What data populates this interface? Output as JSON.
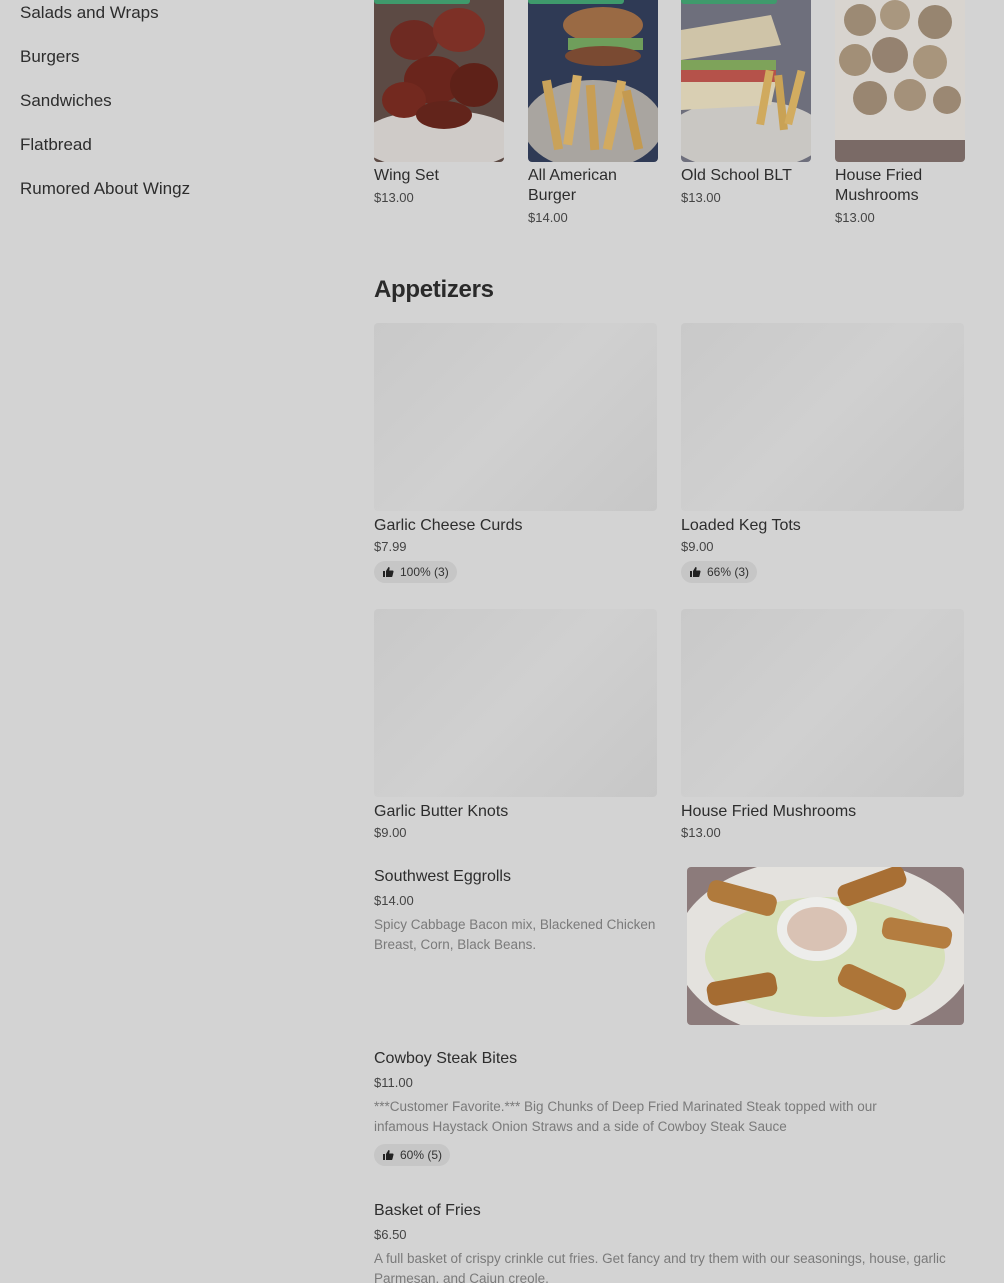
{
  "sidebar": {
    "items": [
      {
        "label": "Salads and Wraps"
      },
      {
        "label": "Burgers"
      },
      {
        "label": "Sandwiches"
      },
      {
        "label": "Flatbread"
      },
      {
        "label": "Rumored About Wingz"
      }
    ]
  },
  "featured": [
    {
      "name": "Wing Set",
      "price": "$13.00"
    },
    {
      "name": "All American Burger",
      "price": "$14.00"
    },
    {
      "name": "Old School BLT",
      "price": "$13.00"
    },
    {
      "name": "House Fried Mushrooms",
      "price": "$13.00"
    }
  ],
  "section": {
    "title": "Appetizers"
  },
  "cards": [
    {
      "name": "Garlic Cheese Curds",
      "price": "$7.99",
      "rating": "100% (3)"
    },
    {
      "name": "Loaded Keg Tots",
      "price": "$9.00",
      "rating": "66% (3)"
    },
    {
      "name": "Garlic Butter Knots",
      "price": "$9.00"
    },
    {
      "name": "House Fried Mushrooms",
      "price": "$13.00"
    }
  ],
  "rows": [
    {
      "name": "Southwest Eggrolls",
      "price": "$14.00",
      "desc": "Spicy Cabbage Bacon mix, Blackened Chicken Breast, Corn, Black Beans."
    },
    {
      "name": "Cowboy Steak Bites",
      "price": "$11.00",
      "desc": "***Customer Favorite.*** Big Chunks of Deep Fried Marinated Steak topped with our infamous Haystack Onion Straws and a side of Cowboy Steak Sauce",
      "rating": "60% (5)"
    },
    {
      "name": "Basket of Fries",
      "price": "$6.50",
      "desc": "A full basket of crispy crinkle cut fries. Get fancy and try them with our seasonings, house, garlic Parmesan, and Cajun creole."
    }
  ],
  "colors": {
    "tag": "#3f9a6c",
    "background": "#d3d3d3"
  }
}
